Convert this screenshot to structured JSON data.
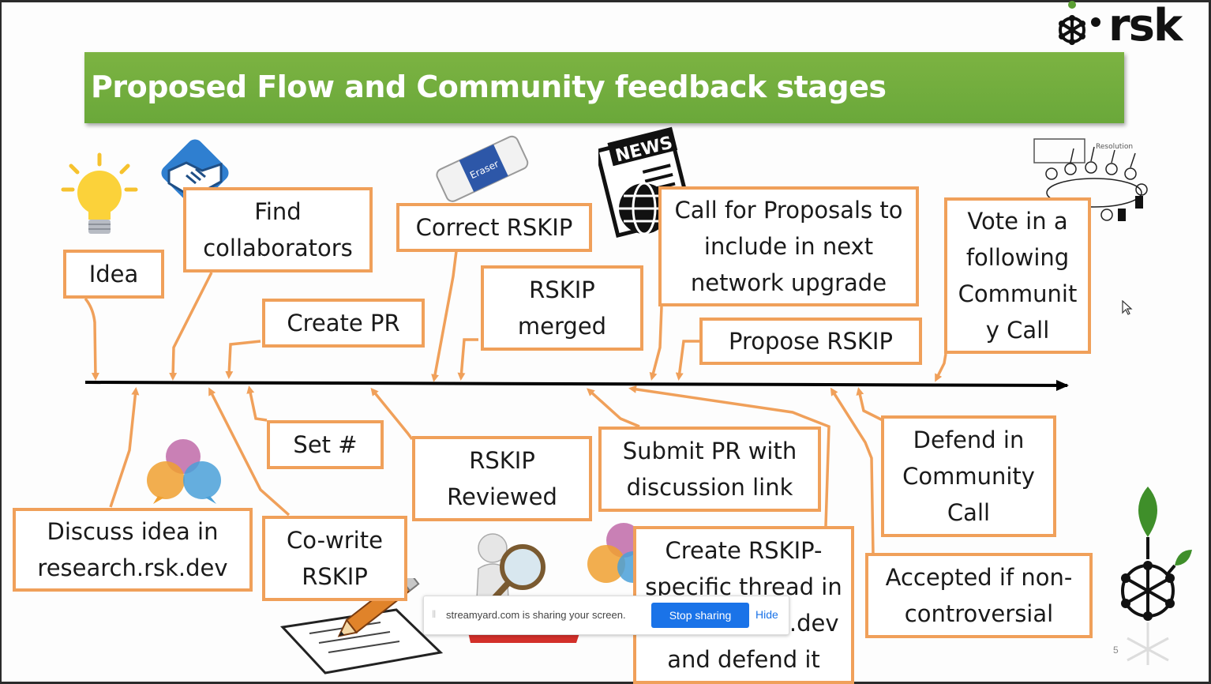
{
  "title": "Proposed Flow and Community feedback stages",
  "logo": {
    "text": "rsk"
  },
  "colors": {
    "title_bar": "#7cb342",
    "box_border": "#f0a05a",
    "arrow": "#f0a05a",
    "timeline": "#000000"
  },
  "stages_above": [
    {
      "id": "idea",
      "label": "Idea"
    },
    {
      "id": "find",
      "label": "Find\ncollaborators"
    },
    {
      "id": "create-pr",
      "label": "Create PR"
    },
    {
      "id": "correct",
      "label": "Correct RSKIP"
    },
    {
      "id": "merged",
      "label": "RSKIP\nmerged"
    },
    {
      "id": "call",
      "label": "Call for Proposals to\ninclude in next\nnetwork upgrade"
    },
    {
      "id": "propose",
      "label": "Propose RSKIP"
    },
    {
      "id": "vote",
      "label": "Vote in a\nfollowing\nCommunit\ny Call"
    }
  ],
  "stages_below": [
    {
      "id": "discuss",
      "label": "Discuss idea in\nresearch.rsk.dev"
    },
    {
      "id": "cowrite",
      "label": "Co-write\nRSKIP"
    },
    {
      "id": "setnum",
      "label": "Set #"
    },
    {
      "id": "reviewed",
      "label": "RSKIP\nReviewed"
    },
    {
      "id": "submit",
      "label": "Submit PR with\ndiscussion link"
    },
    {
      "id": "thread",
      "label": "Create RSKIP-\nspecific thread in\nresearch.rsk.dev\nand defend it"
    },
    {
      "id": "defend",
      "label": "Defend in\nCommunity\nCall"
    },
    {
      "id": "accepted",
      "label": "Accepted if non-\ncontroversial"
    }
  ],
  "screen_share": {
    "message": "streamyard.com is sharing your screen.",
    "stop_label": "Stop sharing",
    "hide_label": "Hide"
  },
  "icons": [
    "lightbulb-icon",
    "handshake-icon",
    "eraser-icon",
    "news-icon",
    "meeting-icon",
    "chat-bubbles-icon",
    "magnifier-person-icon",
    "pencil-paper-icon",
    "rsk-tree-icon"
  ],
  "slide_number": "5"
}
